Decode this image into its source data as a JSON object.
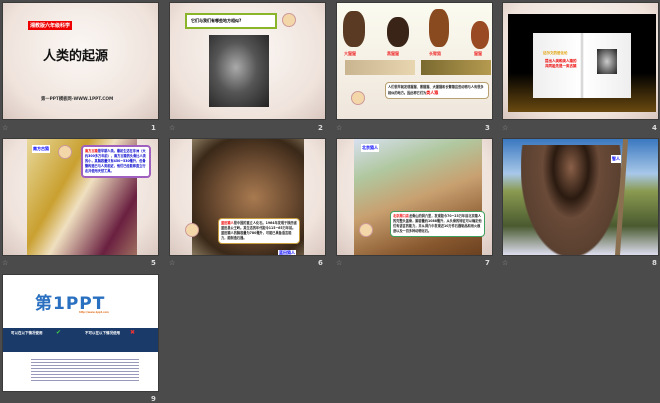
{
  "slides": [
    {
      "number": "1",
      "badge": "湘教版六年级科学",
      "title": "人类的起源",
      "footer": "第一PPT模板网-WWW.1PPT.COM"
    },
    {
      "number": "2",
      "question": "它们与我们有哪些地方相似?"
    },
    {
      "number": "3",
      "labels": [
        "大猩猩",
        "黑猩猩",
        "长臂猿",
        "猩猩"
      ],
      "caption": "人们很早就发现猩猩、黑猩猩、大猩猩和长臂猿这些动物与人有很多相似的地方。因此称它们为",
      "highlight": "类人猿"
    },
    {
      "number": "4",
      "heading": "达尔文的进化论",
      "body": "提出人类和类人猿的共同祖先是一类古猿"
    },
    {
      "number": "5",
      "tag": "南方古猿",
      "highlight": "南方古猿",
      "body": "是早期人类。最初生活在非洲（大约300多万年前），南方古猿的头骨比人类的小，其脑容量只有450~530毫升，但骨骼构造已与人类相近，他们已经能够直立行走并使用天然工具。"
    },
    {
      "number": "6",
      "tag": "蓝田猿人",
      "highlight": "蓝田猿人",
      "body": "是中国的直立人化石。1964年发现于陕西省蓝田县公王岭。其生活的年代距今115~65万年前。蓝田猿人的脑容量为780毫升，可能已具备语言能力，能制造石器。"
    },
    {
      "number": "7",
      "tag": "北京猿人",
      "highlight": "北京周口店",
      "body": "龙骨山的洞穴里，发现距今70~23万年前北京猿人的完整头盖骨，脑容量约1088毫升，从头骨的特征可以确定他们有语言的能力，并从洞穴中发现近10万件石器制品和用火痕迹以及一百多种动物化石。"
    },
    {
      "number": "8",
      "tag": "智人"
    },
    {
      "number": "9",
      "logo": "第1PPT",
      "url": "http://www.1ppt.com",
      "allowed": "可以在以下情况使用",
      "forbidden": "不可以在以下情况使用"
    }
  ]
}
